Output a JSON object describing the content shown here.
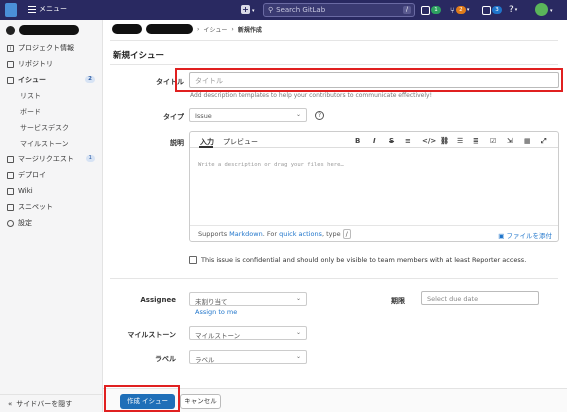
{
  "topbar": {
    "menu_label": "メニュー",
    "search_placeholder": "Search GitLab",
    "search_shortcut": "/",
    "counts": {
      "merge_requests": "1",
      "issues": "2",
      "todos": "3"
    }
  },
  "sidebar": {
    "items": [
      {
        "label": "プロジェクト情報",
        "icon": "info-icon"
      },
      {
        "label": "リポジトリ",
        "icon": "doc-icon"
      },
      {
        "label": "イシュー",
        "icon": "issues-icon",
        "badge": "2"
      },
      {
        "label": "マージリクエスト",
        "icon": "merge-request-icon",
        "badge": "1"
      },
      {
        "label": "デプロイ",
        "icon": "rocket-icon"
      },
      {
        "label": "Wiki",
        "icon": "book-icon"
      },
      {
        "label": "スニペット",
        "icon": "snippet-icon"
      },
      {
        "label": "設定",
        "icon": "gear-icon"
      }
    ],
    "issue_subitems": [
      "リスト",
      "ボード",
      "サービスデスク",
      "マイルストーン"
    ],
    "collapse_label": "サイドバーを隠す"
  },
  "breadcrumb": {
    "issues": "イシュー",
    "current": "新規作成"
  },
  "page_title": "新規イシュー",
  "form": {
    "title_label": "タイトル",
    "title_placeholder": "タイトル",
    "hint": "Add description templates to help your contributors to communicate effectively!",
    "type_label": "タイプ",
    "type_value": "Issue",
    "description_label": "説明",
    "editor": {
      "tab_write": "入力",
      "tab_preview": "プレビュー",
      "placeholder": "Write a description or drag your files here…",
      "supports_prefix": "Supports ",
      "markdown_link": "Markdown",
      "supports_mid": ". For ",
      "quick_actions_link": "quick actions",
      "supports_suffix": ", type ",
      "slash": "/",
      "attach_label": "ファイルを添付"
    },
    "confidential_label": "This issue is confidential and should only be visible to team members with at least Reporter access.",
    "assignee_label": "Assignee",
    "assignee_value": "未割り当て",
    "assign_to_me": "Assign to me",
    "due_label": "期限",
    "due_placeholder": "Select due date",
    "milestone_label": "マイルストーン",
    "milestone_value": "マイルストーン",
    "label_label": "ラベル",
    "label_value": "ラベル"
  },
  "actions": {
    "create": "作成 イシュー",
    "cancel": "キャンセル"
  }
}
